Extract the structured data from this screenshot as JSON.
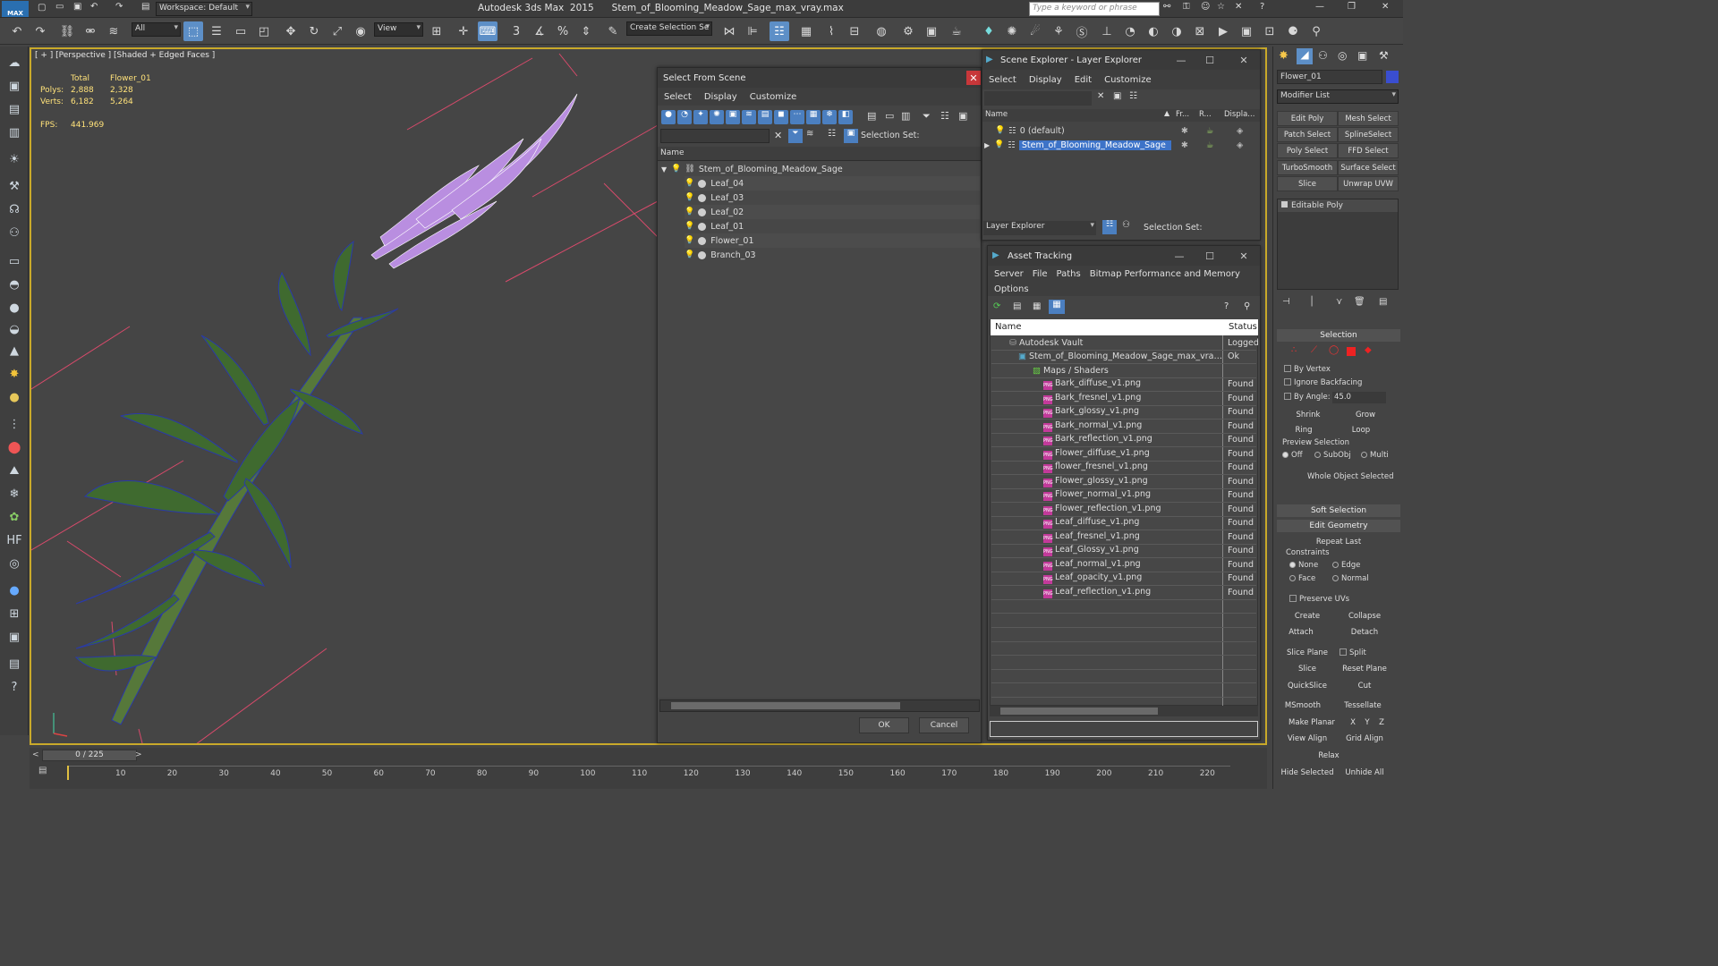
{
  "app": {
    "logo": "MAX",
    "workspace": "Workspace: Default",
    "title": "Autodesk 3ds Max  2015      Stem_of_Blooming_Meadow_Sage_max_vray.max",
    "search_placeholder": "Type a keyword or phrase"
  },
  "toolbar": {
    "filter": "All",
    "refcoord": "View",
    "create_selection_set": "Create Selection Se",
    "snap_label": "3"
  },
  "viewport": {
    "label": "[ + ] [Perspective ] [Shaded + Edged Faces ]",
    "stats": {
      "col_total": "Total",
      "col_obj": "Flower_01",
      "polys_label": "Polys:",
      "polys_total": "2,888",
      "polys_obj": "2,328",
      "verts_label": "Verts:",
      "verts_total": "6,182",
      "verts_obj": "5,264",
      "fps_label": "FPS:",
      "fps": "441.969"
    }
  },
  "select_from_scene": {
    "title": "Select From Scene",
    "menus": [
      "Select",
      "Display",
      "Customize"
    ],
    "selection_set_label": "Selection Set:",
    "col_name": "Name",
    "root": "Stem_of_Blooming_Meadow_Sage",
    "items": [
      "Leaf_04",
      "Leaf_03",
      "Leaf_02",
      "Leaf_01",
      "Flower_01",
      "Branch_03"
    ],
    "ok": "OK",
    "cancel": "Cancel"
  },
  "scene_explorer": {
    "title": "Scene Explorer - Layer Explorer",
    "menus": [
      "Select",
      "Display",
      "Edit",
      "Customize"
    ],
    "cols": [
      "Name",
      "Fr...",
      "R...",
      "Displa..."
    ],
    "rows": [
      "0 (default)",
      "Stem_of_Blooming_Meadow_Sage"
    ],
    "explorer_combo": "Layer Explorer",
    "selection_set_label": "Selection Set:"
  },
  "asset_tracking": {
    "title": "Asset Tracking",
    "menus": [
      "Server",
      "File",
      "Paths",
      "Bitmap Performance and Memory"
    ],
    "menu2": "Options",
    "col_name": "Name",
    "col_status": "Status",
    "vault": "Autodesk Vault",
    "vault_status": "Logged",
    "file": "Stem_of_Blooming_Meadow_Sage_max_vray.max",
    "file_status": "Ok",
    "maps": "Maps / Shaders",
    "files": [
      {
        "name": "Bark_diffuse_v1.png",
        "status": "Found"
      },
      {
        "name": "Bark_fresnel_v1.png",
        "status": "Found"
      },
      {
        "name": "Bark_glossy_v1.png",
        "status": "Found"
      },
      {
        "name": "Bark_normal_v1.png",
        "status": "Found"
      },
      {
        "name": "Bark_reflection_v1.png",
        "status": "Found"
      },
      {
        "name": "Flower_diffuse_v1.png",
        "status": "Found"
      },
      {
        "name": "flower_fresnel_v1.png",
        "status": "Found"
      },
      {
        "name": "Flower_glossy_v1.png",
        "status": "Found"
      },
      {
        "name": "Flower_normal_v1.png",
        "status": "Found"
      },
      {
        "name": "Flower_reflection_v1.png",
        "status": "Found"
      },
      {
        "name": "Leaf_diffuse_v1.png",
        "status": "Found"
      },
      {
        "name": "Leaf_fresnel_v1.png",
        "status": "Found"
      },
      {
        "name": "Leaf_Glossy_v1.png",
        "status": "Found"
      },
      {
        "name": "Leaf_normal_v1.png",
        "status": "Found"
      },
      {
        "name": "Leaf_opacity_v1.png",
        "status": "Found"
      },
      {
        "name": "Leaf_reflection_v1.png",
        "status": "Found"
      }
    ]
  },
  "command_panel": {
    "object_name": "Flower_01",
    "modifier_list": "Modifier List",
    "mod_buttons": [
      "Edit Poly",
      "Mesh Select",
      "Patch Select",
      "SplineSelect",
      "Poly Select",
      "FFD Select",
      "TurboSmooth",
      "Surface Select",
      "Slice",
      "Unwrap UVW"
    ],
    "stack_item": "Editable Poly",
    "selection_rollout": "Selection",
    "by_vertex": "By Vertex",
    "ignore_backfacing": "Ignore Backfacing",
    "by_angle": "By Angle:",
    "angle_value": "45.0",
    "shrink": "Shrink",
    "grow": "Grow",
    "ring": "Ring",
    "loop": "Loop",
    "preview_selection": "Preview Selection",
    "preview_off": "Off",
    "preview_subobj": "SubObj",
    "preview_multi": "Multi",
    "whole_object": "Whole Object Selected",
    "soft_selection": "Soft Selection",
    "edit_geometry": "Edit Geometry",
    "repeat_last": "Repeat Last",
    "constraints": "Constraints",
    "c_none": "None",
    "c_edge": "Edge",
    "c_face": "Face",
    "c_normal": "Normal",
    "preserve_uvs": "Preserve UVs",
    "create": "Create",
    "collapse": "Collapse",
    "attach": "Attach",
    "detach": "Detach",
    "slice_plane": "Slice Plane",
    "split": "Split",
    "slice": "Slice",
    "reset_plane": "Reset Plane",
    "quickslice": "QuickSlice",
    "cut": "Cut",
    "msmooth": "MSmooth",
    "tessellate": "Tessellate",
    "make_planar": "Make Planar",
    "x": "X",
    "y": "Y",
    "z": "Z",
    "view_align": "View Align",
    "grid_align": "Grid Align",
    "relax": "Relax",
    "hide_selected": "Hide Selected",
    "unhide_all": "Unhide All"
  },
  "timeline": {
    "frame": "0 / 225",
    "ticks": [
      "10",
      "20",
      "30",
      "40",
      "50",
      "60",
      "70",
      "80",
      "90",
      "100",
      "110",
      "120",
      "130",
      "140",
      "150",
      "160",
      "170",
      "180",
      "190",
      "200",
      "210",
      "220"
    ]
  },
  "colors": {
    "accent": "#5d8fc7",
    "viewport_border": "#c9a92a",
    "leaf": "#3f6a2f",
    "flower": "#b98ee0",
    "stats": "#ffe27a"
  }
}
